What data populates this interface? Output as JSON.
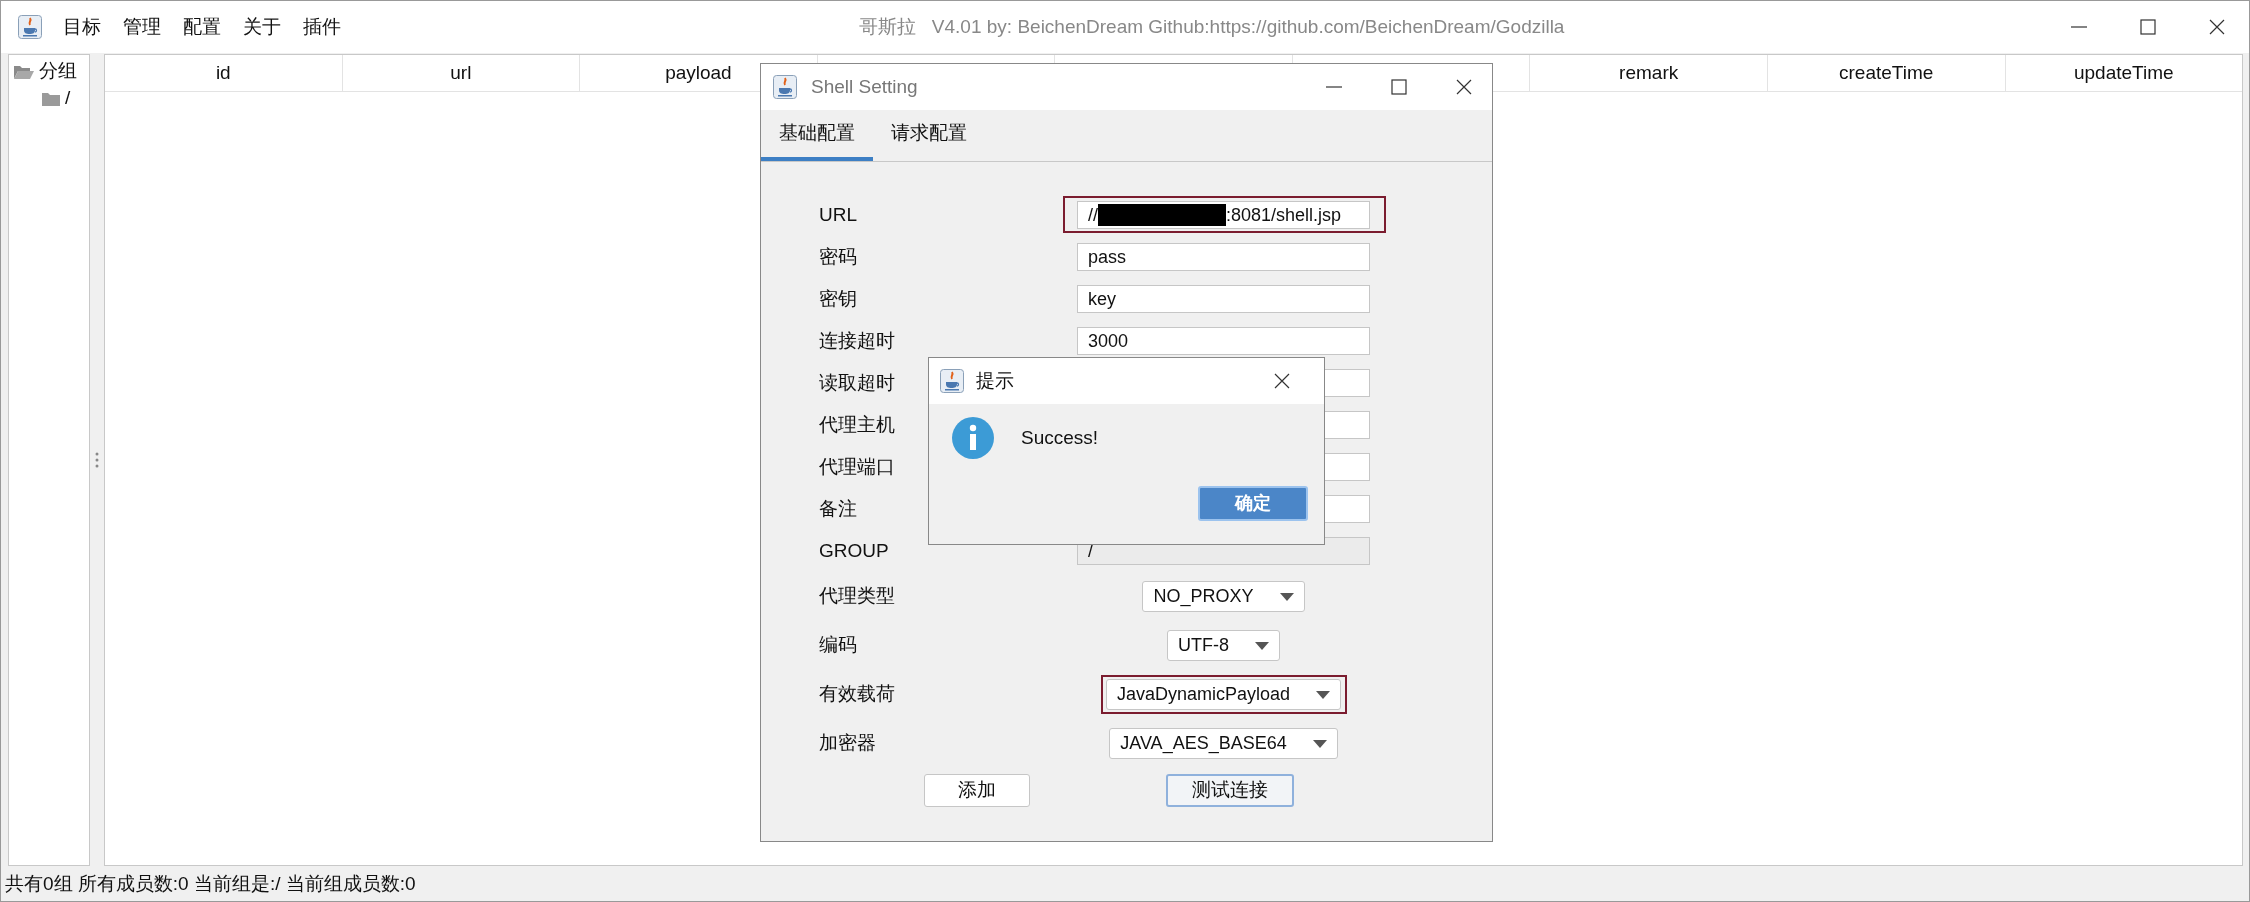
{
  "window": {
    "title": "哥斯拉   V4.01 by: BeichenDream Github:https://github.com/BeichenDream/Godzilla"
  },
  "menu": [
    "目标",
    "管理",
    "配置",
    "关于",
    "插件"
  ],
  "tree": [
    {
      "label": "分组",
      "expanded": true,
      "children": [
        {
          "label": "/",
          "expanded": false
        }
      ]
    }
  ],
  "table": {
    "columns": [
      {
        "label": "id"
      },
      {
        "label": "url"
      },
      {
        "label": "payload"
      },
      {},
      {},
      {},
      {
        "label": "remark"
      },
      {
        "label": "createTime"
      },
      {
        "label": "updateTime"
      }
    ]
  },
  "status_bar": "共有0组 所有成员数:0 当前组是:/ 当前组成员数:0",
  "shell_setting": {
    "title": "Shell Setting",
    "tabs": [
      {
        "label": "基础配置",
        "selected": true
      },
      {
        "label": "请求配置",
        "selected": false
      }
    ],
    "fields": [
      {
        "kind": "text",
        "label": "URL",
        "value": "//",
        "redacted": true,
        "value_end": ":8081/shell.jsp",
        "highlighted": true
      },
      {
        "kind": "text",
        "label": "密码",
        "value": "pass"
      },
      {
        "kind": "text",
        "label": "密钥",
        "value": "key"
      },
      {
        "kind": "text",
        "label": "连接超时",
        "value": "3000"
      },
      {
        "kind": "text",
        "label": "读取超时"
      },
      {
        "kind": "text",
        "label": "代理主机"
      },
      {
        "kind": "text",
        "label": "代理端口"
      },
      {
        "kind": "text",
        "label": "备注"
      },
      {
        "kind": "text",
        "label": "GROUP",
        "value": "/",
        "disabled": true
      },
      {
        "kind": "select",
        "label": "代理类型",
        "value": "NO_PROXY"
      },
      {
        "kind": "select",
        "label": "编码",
        "value": "UTF-8"
      },
      {
        "kind": "select",
        "label": "有效载荷",
        "value": "JavaDynamicPayload",
        "highlighted": true
      },
      {
        "kind": "select",
        "label": "加密器",
        "value": "JAVA_AES_BASE64"
      }
    ],
    "buttons": [
      {
        "label": "添加",
        "focused": false
      },
      {
        "label": "测试连接",
        "focused": true
      }
    ]
  },
  "message_dialog": {
    "title": "提示",
    "message": "Success!",
    "button": "确定"
  }
}
